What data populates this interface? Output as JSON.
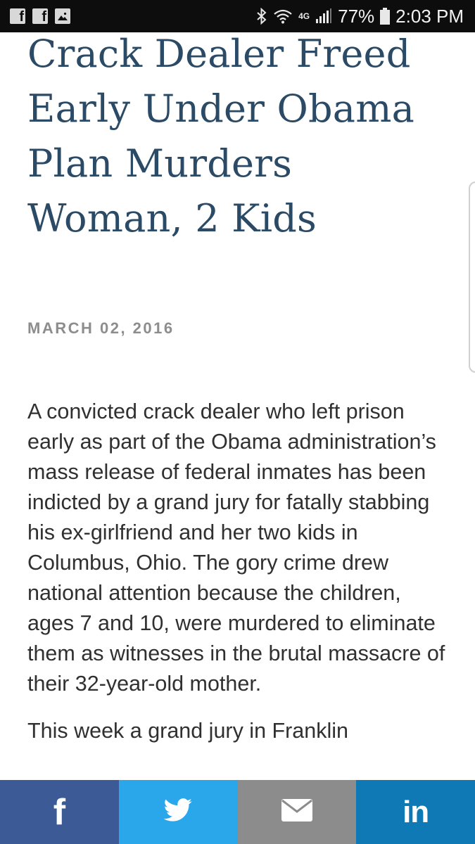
{
  "status_bar": {
    "notification_icons": [
      "facebook-icon",
      "facebook-icon",
      "image-icon"
    ],
    "network_label": "4G",
    "battery_percent": "77%",
    "time": "2:03 PM"
  },
  "article": {
    "headline": "Crack Dealer Freed Early Under Obama Plan Murders Woman, 2 Kids",
    "date": "MARCH 02, 2016",
    "paragraphs": [
      "A convicted crack dealer who left prison early as part of the Obama administration’s mass release of federal inmates has been indicted by a grand jury for fatally stabbing his ex-girlfriend and her two kids in Columbus, Ohio. The gory crime drew national attention because the children, ages 7 and 10, were murdered to eliminate them as witnesses in the brutal massacre of their 32-year-old mother.",
      "This week a grand jury in Franklin"
    ]
  },
  "share_bar": {
    "facebook_label": "f",
    "linkedin_label": "in",
    "colors": {
      "facebook": "#3b5a96",
      "twitter": "#2aa6ea",
      "email": "#8c8c8c",
      "linkedin": "#0f79b6"
    }
  },
  "theme": {
    "headline_color": "#2b4a66",
    "date_color": "#8d8d8d",
    "body_color": "#303030"
  }
}
